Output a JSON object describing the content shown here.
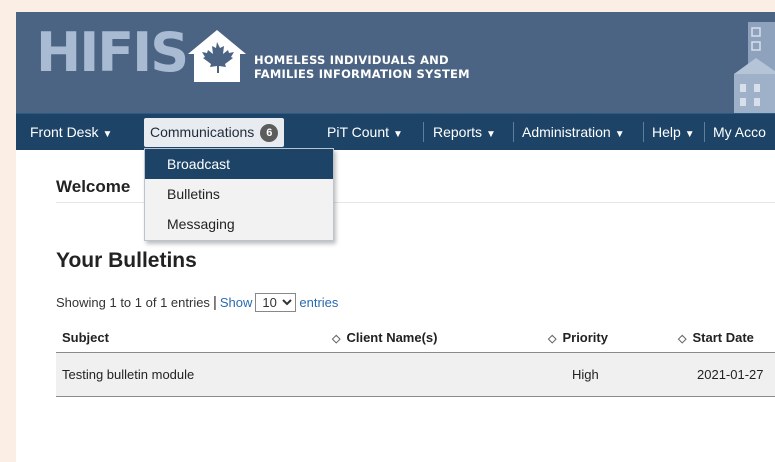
{
  "brand": {
    "logo_letters": "HIFIS",
    "name_line1": "HOMELESS INDIVIDUALS AND",
    "name_line2": "FAMILIES INFORMATION SYSTEM",
    "colors": {
      "banner": "#4c6483",
      "navbar": "#1d4467",
      "accent_link": "#2a6ab0"
    }
  },
  "nav": {
    "front_desk": "Front Desk",
    "communications": "Communications",
    "communications_badge": "6",
    "pit_count": "PiT Count",
    "reports": "Reports",
    "administration": "Administration",
    "help": "Help",
    "my_account": "My Acco",
    "chevron_icon": "chevron-down-icon"
  },
  "dropdown": {
    "items": [
      {
        "label": "Broadcast",
        "highlighted": true
      },
      {
        "label": "Bulletins",
        "highlighted": false
      },
      {
        "label": "Messaging",
        "highlighted": false
      }
    ]
  },
  "main": {
    "welcome": "Welcome",
    "bulletins_title": "Your Bulletins",
    "showing": "Showing 1 to 1 of 1 entries",
    "separator": "|",
    "show_label": "Show",
    "page_size": "10",
    "page_size_options": [
      "10"
    ],
    "entries_label": "entries"
  },
  "table": {
    "columns": [
      "Subject",
      "Client Name(s)",
      "Priority",
      "Start Date"
    ],
    "rows": [
      {
        "subject": "Testing bulletin module",
        "client_names": "",
        "priority": "High",
        "start_date": "2021-01-27"
      }
    ]
  }
}
